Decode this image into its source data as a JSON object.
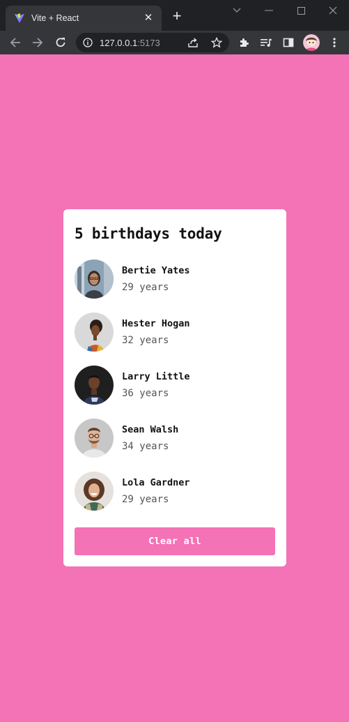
{
  "browser": {
    "tab_title": "Vite + React",
    "url_host": "127.0.0.1",
    "url_port": ":5173"
  },
  "colors": {
    "page_bg": "#f472b6",
    "card_bg": "#ffffff",
    "button_bg": "#f472b6"
  },
  "app": {
    "title": "5 birthdays today",
    "people": [
      {
        "name": "Bertie Yates",
        "age": "29 years"
      },
      {
        "name": "Hester Hogan",
        "age": "32 years"
      },
      {
        "name": "Larry Little",
        "age": "36 years"
      },
      {
        "name": "Sean Walsh",
        "age": "34 years"
      },
      {
        "name": "Lola Gardner",
        "age": "29 years"
      }
    ],
    "clear_label": "Clear all"
  }
}
